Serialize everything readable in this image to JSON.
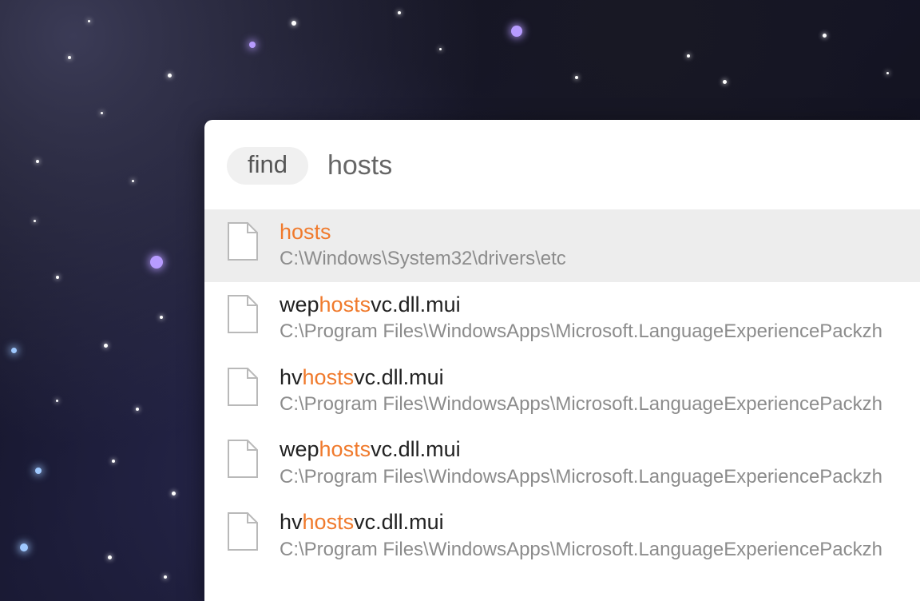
{
  "search": {
    "scope_label": "find",
    "query": "hosts",
    "highlight": "hosts",
    "highlight_color": "#f07a2c"
  },
  "results": [
    {
      "name_pre": "",
      "name_match": "hosts",
      "name_post": "",
      "path": "C:\\Windows\\System32\\drivers\\etc",
      "selected": true
    },
    {
      "name_pre": "wep",
      "name_match": "hosts",
      "name_post": "vc.dll.mui",
      "path": "C:\\Program Files\\WindowsApps\\Microsoft.LanguageExperiencePackzh",
      "selected": false
    },
    {
      "name_pre": "hv",
      "name_match": "hosts",
      "name_post": "vc.dll.mui",
      "path": "C:\\Program Files\\WindowsApps\\Microsoft.LanguageExperiencePackzh",
      "selected": false
    },
    {
      "name_pre": "wep",
      "name_match": "hosts",
      "name_post": "vc.dll.mui",
      "path": "C:\\Program Files\\WindowsApps\\Microsoft.LanguageExperiencePackzh",
      "selected": false
    },
    {
      "name_pre": "hv",
      "name_match": "hosts",
      "name_post": "vc.dll.mui",
      "path": "C:\\Program Files\\WindowsApps\\Microsoft.LanguageExperiencePackzh",
      "selected": false
    }
  ]
}
